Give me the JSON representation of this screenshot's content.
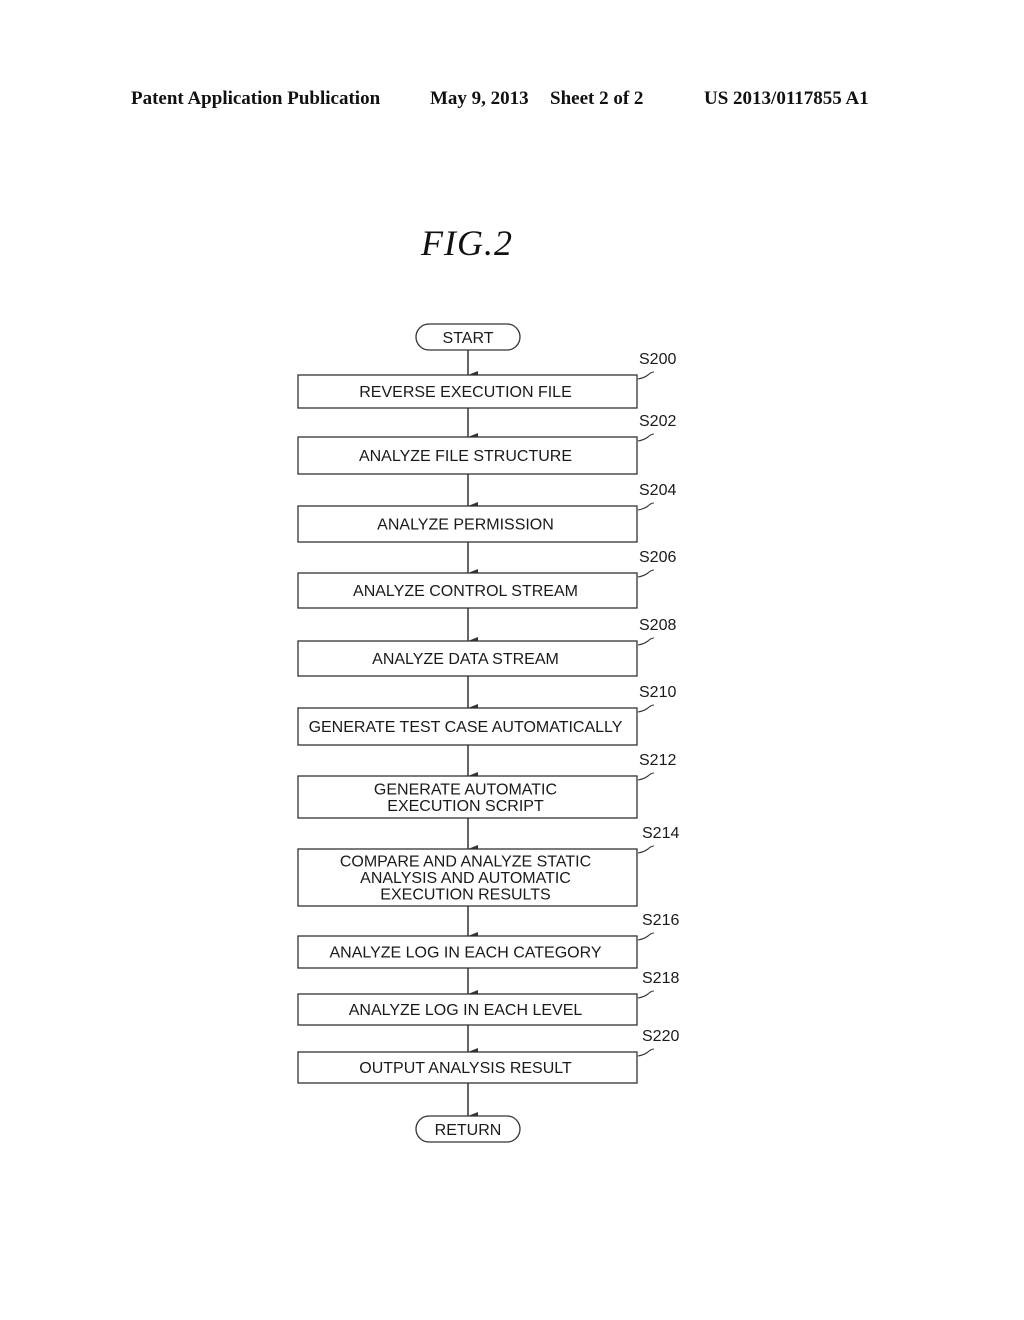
{
  "header": {
    "publication": "Patent Application Publication",
    "date": "May 9, 2013",
    "sheet": "Sheet 2 of 2",
    "number": "US 2013/0117855 A1"
  },
  "figure": {
    "title": "FIG.2"
  },
  "flowchart": {
    "start": "START",
    "end": "RETURN",
    "steps": [
      {
        "ref": "S200",
        "lines": [
          "REVERSE EXECUTION FILE"
        ]
      },
      {
        "ref": "S202",
        "lines": [
          "ANALYZE FILE STRUCTURE"
        ]
      },
      {
        "ref": "S204",
        "lines": [
          "ANALYZE PERMISSION"
        ]
      },
      {
        "ref": "S206",
        "lines": [
          "ANALYZE CONTROL STREAM"
        ]
      },
      {
        "ref": "S208",
        "lines": [
          "ANALYZE DATA STREAM"
        ]
      },
      {
        "ref": "S210",
        "lines": [
          "GENERATE TEST CASE AUTOMATICALLY"
        ]
      },
      {
        "ref": "S212",
        "lines": [
          "GENERATE AUTOMATIC",
          "EXECUTION SCRIPT"
        ]
      },
      {
        "ref": "S214",
        "lines": [
          "COMPARE AND ANALYZE STATIC",
          "ANALYSIS AND AUTOMATIC",
          "EXECUTION RESULTS"
        ]
      },
      {
        "ref": "S216",
        "lines": [
          "ANALYZE LOG IN EACH CATEGORY"
        ]
      },
      {
        "ref": "S218",
        "lines": [
          "ANALYZE LOG IN EACH LEVEL"
        ]
      },
      {
        "ref": "S220",
        "lines": [
          "OUTPUT ANALYSIS RESULT"
        ]
      }
    ]
  }
}
